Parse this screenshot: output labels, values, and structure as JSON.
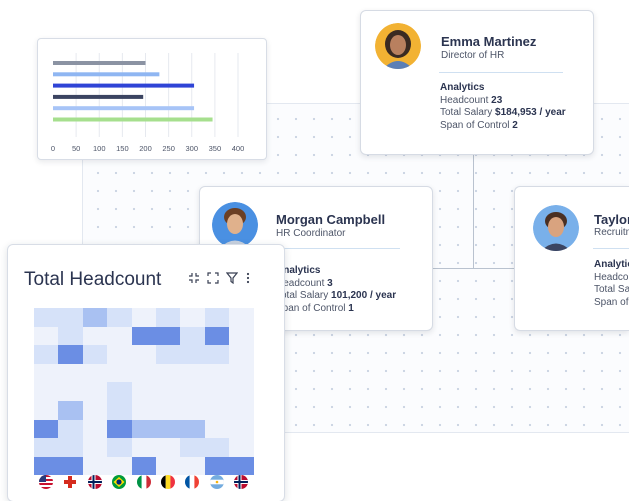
{
  "org": {
    "cards": [
      {
        "name": "Emma Martinez",
        "role": "Director of HR",
        "analytics_label": "Analytics",
        "headcount_label": "Headcount",
        "headcount": "23",
        "salary_label": "Total Salary",
        "salary": "$184,953 / year",
        "span_label": "Span of Control",
        "span": "2",
        "avatar_bg": "#f2b233"
      },
      {
        "name": "Morgan Campbell",
        "role": "HR Coordinator",
        "analytics_label": "Analytics",
        "headcount_label": "Headcount",
        "headcount": "3",
        "salary_label": "Total Salary",
        "salary": "101,200 / year",
        "span_label": "Span of Control",
        "span": "1",
        "avatar_bg": "#4a90e2"
      },
      {
        "name": "Taylor M",
        "role": "Recruitm",
        "analytics_label": "Analytics",
        "headcount_label": "Headcou",
        "salary_label": "Total Sala",
        "span_label": "Span of C",
        "avatar_bg": "#79b0ea"
      }
    ]
  },
  "chart_data": {
    "type": "bar",
    "orientation": "horizontal",
    "values": [
      200,
      230,
      305,
      195,
      305,
      345
    ],
    "colors": [
      "#8b93a3",
      "#8fb6f2",
      "#2f44d6",
      "#3b4461",
      "#a7c4f7",
      "#a6df8e"
    ],
    "xticks": [
      "0",
      "50",
      "100",
      "150",
      "200",
      "250",
      "300",
      "350",
      "400"
    ],
    "xlim": [
      0,
      400
    ],
    "grid": true
  },
  "heatmap": {
    "title": "Total Headcount",
    "icons": [
      "collapse-icon",
      "expand-icon",
      "filter-icon",
      "more-icon"
    ],
    "cells": [
      [
        2,
        2,
        3,
        2,
        1,
        2,
        1,
        2,
        1
      ],
      [
        1,
        2,
        1,
        1,
        4,
        4,
        2,
        4,
        1
      ],
      [
        2,
        4,
        2,
        1,
        1,
        2,
        2,
        2,
        1
      ],
      [
        1,
        1,
        1,
        1,
        1,
        1,
        1,
        1,
        1
      ],
      [
        1,
        1,
        1,
        2,
        1,
        1,
        1,
        1,
        1
      ],
      [
        1,
        3,
        1,
        2,
        1,
        1,
        1,
        1,
        1
      ],
      [
        4,
        2,
        1,
        4,
        3,
        3,
        3,
        1,
        1
      ],
      [
        2,
        2,
        1,
        2,
        1,
        1,
        2,
        2,
        1
      ],
      [
        4,
        4,
        1,
        1,
        4,
        1,
        1,
        4,
        4
      ]
    ],
    "palette": [
      "#ffffff",
      "#eef2fb",
      "#d6e2f9",
      "#a9c1f2",
      "#6b8ee4"
    ],
    "flags": [
      "usa",
      "switzerland",
      "norway",
      "brazil",
      "italy",
      "belgium",
      "france",
      "argentina",
      "norway"
    ]
  }
}
